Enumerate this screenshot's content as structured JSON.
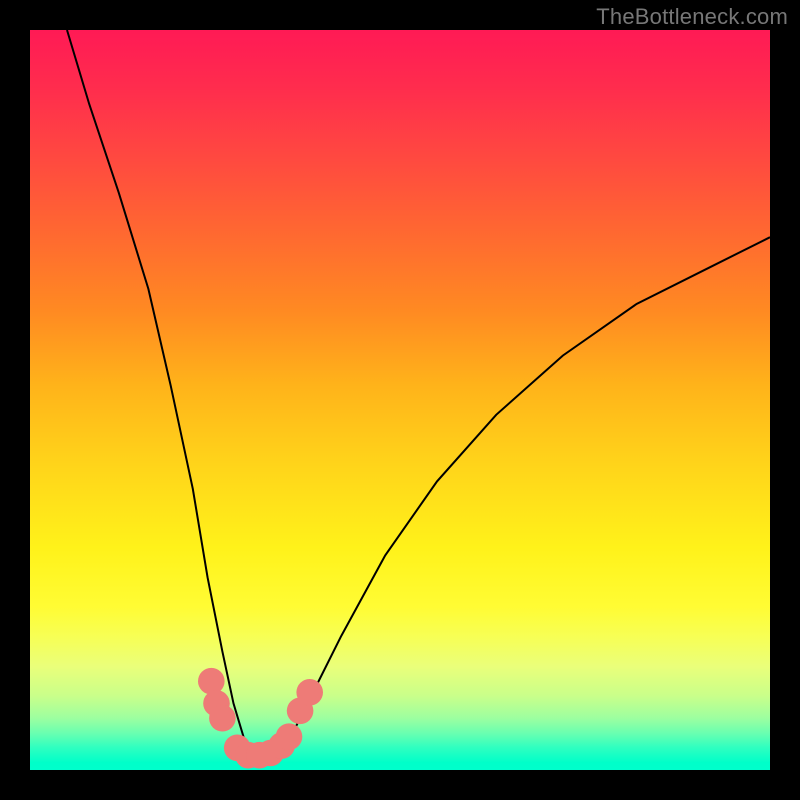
{
  "watermark": "TheBottleneck.com",
  "chart_data": {
    "type": "line",
    "title": "",
    "xlabel": "",
    "ylabel": "",
    "xlim": [
      0,
      100
    ],
    "ylim": [
      0,
      100
    ],
    "series": [
      {
        "name": "bottleneck-curve",
        "x": [
          5,
          8,
          12,
          16,
          19,
          22,
          24,
          26,
          27.5,
          29,
          30.5,
          32,
          34,
          36,
          38,
          42,
          48,
          55,
          63,
          72,
          82,
          92,
          100
        ],
        "values": [
          100,
          90,
          78,
          65,
          52,
          38,
          26,
          16,
          9,
          4,
          2,
          2,
          3,
          6,
          10,
          18,
          29,
          39,
          48,
          56,
          63,
          68,
          72
        ]
      }
    ],
    "markers": [
      {
        "x": 24.5,
        "y": 12,
        "label": "left-upper-dot"
      },
      {
        "x": 25.2,
        "y": 9,
        "label": "left-mid-dot"
      },
      {
        "x": 26.0,
        "y": 7,
        "label": "left-lower-dot"
      },
      {
        "x": 28.0,
        "y": 3.0,
        "label": "valley-dot-1"
      },
      {
        "x": 29.5,
        "y": 2.0,
        "label": "valley-dot-2"
      },
      {
        "x": 31.0,
        "y": 2.0,
        "label": "valley-dot-3"
      },
      {
        "x": 32.5,
        "y": 2.3,
        "label": "valley-dot-4"
      },
      {
        "x": 34.0,
        "y": 3.3,
        "label": "valley-dot-5"
      },
      {
        "x": 35.0,
        "y": 4.5,
        "label": "valley-dot-6"
      },
      {
        "x": 36.5,
        "y": 8,
        "label": "right-lower-dot"
      },
      {
        "x": 37.8,
        "y": 10.5,
        "label": "right-upper-dot"
      }
    ],
    "marker_style": {
      "radius_percent": 1.8,
      "color": "#ee7b77"
    },
    "curve_style": {
      "stroke": "#000000",
      "width": 2
    }
  }
}
